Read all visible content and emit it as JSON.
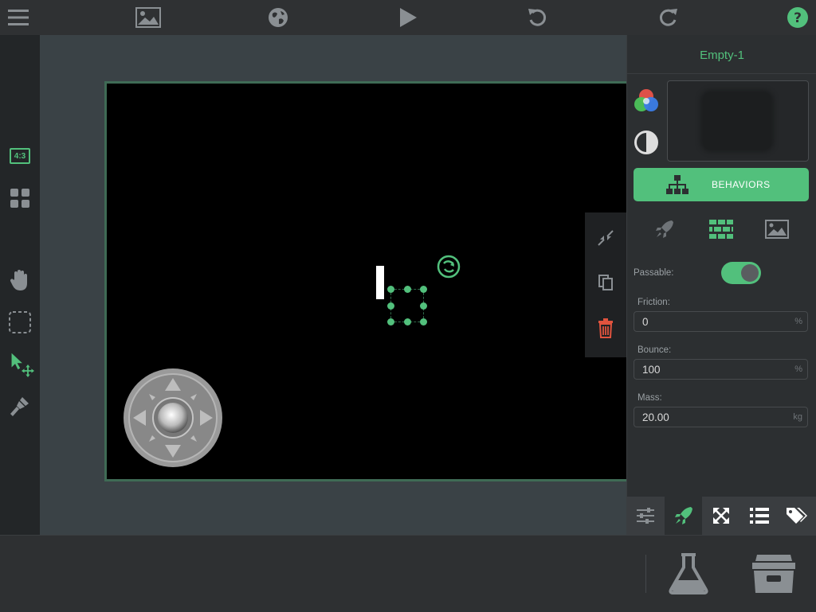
{
  "toolbar": {
    "menu_icon": "hamburger-menu-icon",
    "image_icon": "image-icon",
    "globe_icon": "globe-icon",
    "play_icon": "play-icon",
    "undo_icon": "undo-icon",
    "redo_icon": "redo-icon",
    "help_icon": "help-icon"
  },
  "left_tools": {
    "aspect_label": "4:3",
    "tools": [
      "grid-icon",
      "hand-icon",
      "selection-icon",
      "pointer-move-icon",
      "brush-icon"
    ]
  },
  "object_panel": {
    "name": "Empty-1",
    "behaviors_label": "BEHAVIORS",
    "passable_label": "Passable:",
    "passable_on": true,
    "friction": {
      "label": "Friction:",
      "value": "0",
      "unit": "%"
    },
    "bounce": {
      "label": "Bounce:",
      "value": "100",
      "unit": "%"
    },
    "mass": {
      "label": "Mass:",
      "value": "20.00",
      "unit": "kg"
    }
  },
  "colors": {
    "accent": "#52c07c",
    "delete": "#e0533e",
    "stage": "#000000"
  }
}
